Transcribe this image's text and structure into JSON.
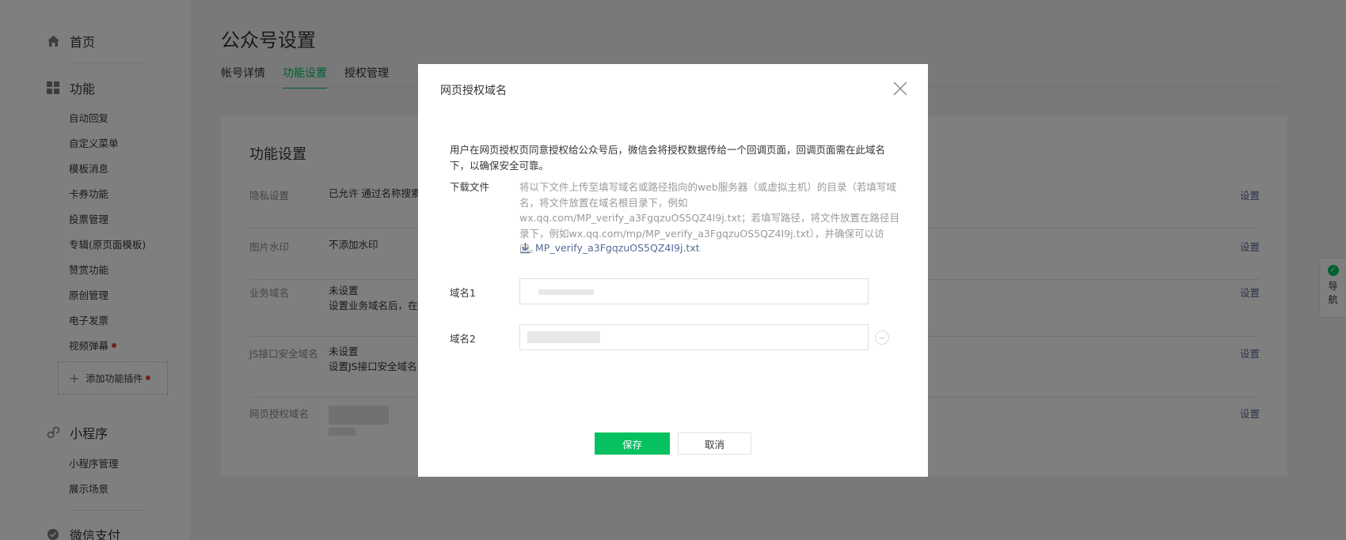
{
  "sidebar": {
    "home": "首页",
    "features": "功能",
    "feature_items": [
      "自动回复",
      "自定义菜单",
      "模板消息",
      "卡券功能",
      "投票管理",
      "专辑(原页面模板)",
      "赞赏功能",
      "原创管理",
      "电子发票",
      "视频弹幕"
    ],
    "add_plugin": "添加功能插件",
    "miniprogram": "小程序",
    "miniprogram_items": [
      "小程序管理",
      "展示场景"
    ],
    "wechat_pay": "微信支付"
  },
  "main": {
    "title": "公众号设置",
    "tabs": [
      "帐号详情",
      "功能设置",
      "授权管理"
    ],
    "card_title": "功能设置",
    "rows": [
      {
        "label": "隐私设置",
        "value": "已允许 通过名称搜索",
        "action": "设置"
      },
      {
        "label": "图片水印",
        "value": "不添加水印",
        "action": "设置"
      },
      {
        "label": "业务域名",
        "value": "未设置",
        "value2": "设置业务域名后，在",
        "action": "设置"
      },
      {
        "label": "JS接口安全域名",
        "value": "未设置",
        "value2": "设置JS接口安全域名",
        "action": "设置"
      },
      {
        "label": "网页授权域名",
        "value": "",
        "action": "设置"
      }
    ]
  },
  "guide": {
    "label1": "导",
    "label2": "航"
  },
  "dialog": {
    "title": "网页授权域名",
    "description": "用户在网页授权页同意授权给公众号后，微信会将授权数据传给一个回调页面，回调页面需在此域名下，以确保安全可靠。",
    "download_label": "下载文件",
    "download_text": "将以下文件上传至填写域名或路径指向的web服务器（或虚拟主机）的目录（若填写域名，将文件放置在域名根目录下，例如wx.qq.com/MP_verify_a3FgqzuOS5QZ4I9j.txt；若填写路径，将文件放置在路径目录下，例如wx.qq.com/mp/MP_verify_a3FgqzuOS5QZ4I9j.txt），并确保可以访问。",
    "download_file": "MP_verify_a3FgqzuOS5QZ4I9j.txt",
    "domain1_label": "域名1",
    "domain1_value": "",
    "domain2_label": "域名2",
    "domain2_value": "",
    "save": "保存",
    "cancel": "取消"
  },
  "colors": {
    "accent": "#07c160",
    "link": "#576b95",
    "badge": "#e64340"
  }
}
